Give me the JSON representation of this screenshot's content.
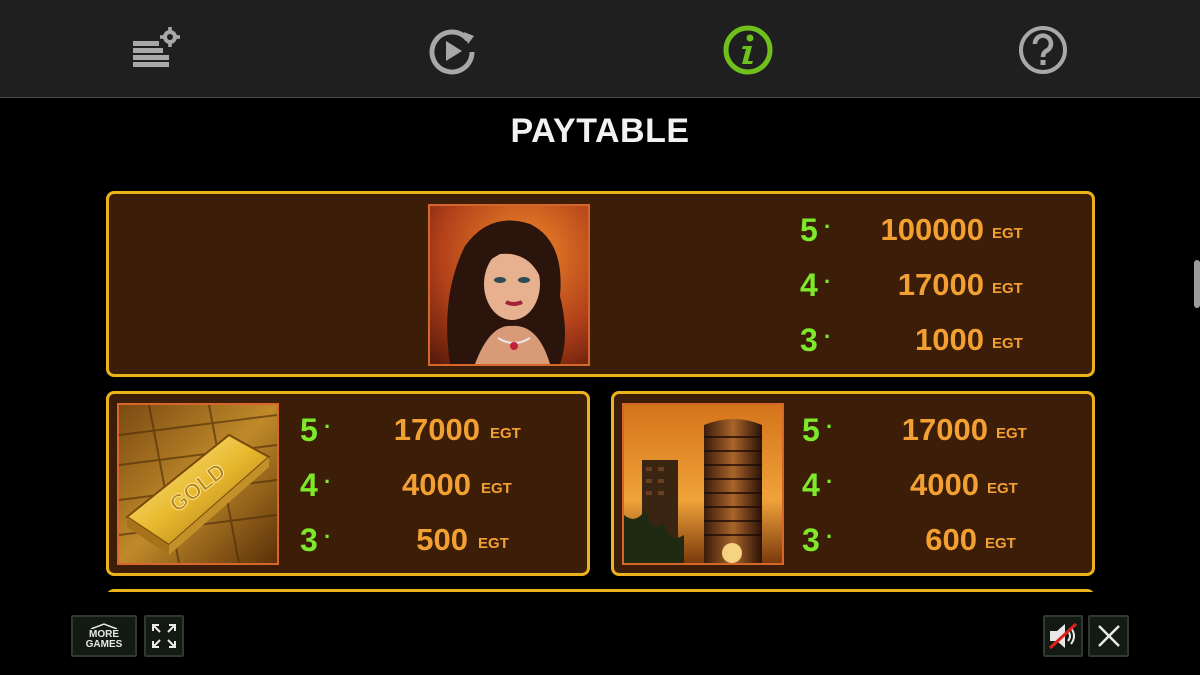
{
  "nav": {
    "items": [
      {
        "name": "settings",
        "icon": "bet-settings-icon",
        "active": false
      },
      {
        "name": "autoplay",
        "icon": "autoplay-icon",
        "active": false
      },
      {
        "name": "info",
        "icon": "info-icon",
        "active": true
      },
      {
        "name": "help",
        "icon": "help-icon",
        "active": false
      }
    ],
    "active_color": "#6fbf1d",
    "inactive_color": "#a8a8a8"
  },
  "page": {
    "title": "PAYTABLE"
  },
  "paytable": {
    "featured": {
      "symbol": "woman-symbol",
      "rows": [
        {
          "count": "5",
          "amount": "100000",
          "unit": "EGT"
        },
        {
          "count": "4",
          "amount": "17000",
          "unit": "EGT"
        },
        {
          "count": "3",
          "amount": "1000",
          "unit": "EGT"
        }
      ]
    },
    "gold": {
      "symbol": "gold-bar-symbol",
      "rows": [
        {
          "count": "5",
          "amount": "17000",
          "unit": "EGT"
        },
        {
          "count": "4",
          "amount": "4000",
          "unit": "EGT"
        },
        {
          "count": "3",
          "amount": "500",
          "unit": "EGT"
        }
      ]
    },
    "tower": {
      "symbol": "skyscraper-symbol",
      "rows": [
        {
          "count": "5",
          "amount": "17000",
          "unit": "EGT"
        },
        {
          "count": "4",
          "amount": "4000",
          "unit": "EGT"
        },
        {
          "count": "3",
          "amount": "600",
          "unit": "EGT"
        }
      ]
    }
  },
  "bottom": {
    "more_games_line1": "MORE",
    "more_games_line2": "GAMES",
    "fullscreen_icon": "fullscreen-icon",
    "sound_icon": "sound-muted-icon",
    "close_icon": "close-icon"
  },
  "colors": {
    "panel_border": "#ecb21c",
    "panel_bg": "#3c1d08",
    "count_green": "#7ee82a",
    "amount_orange": "#f3a033"
  }
}
